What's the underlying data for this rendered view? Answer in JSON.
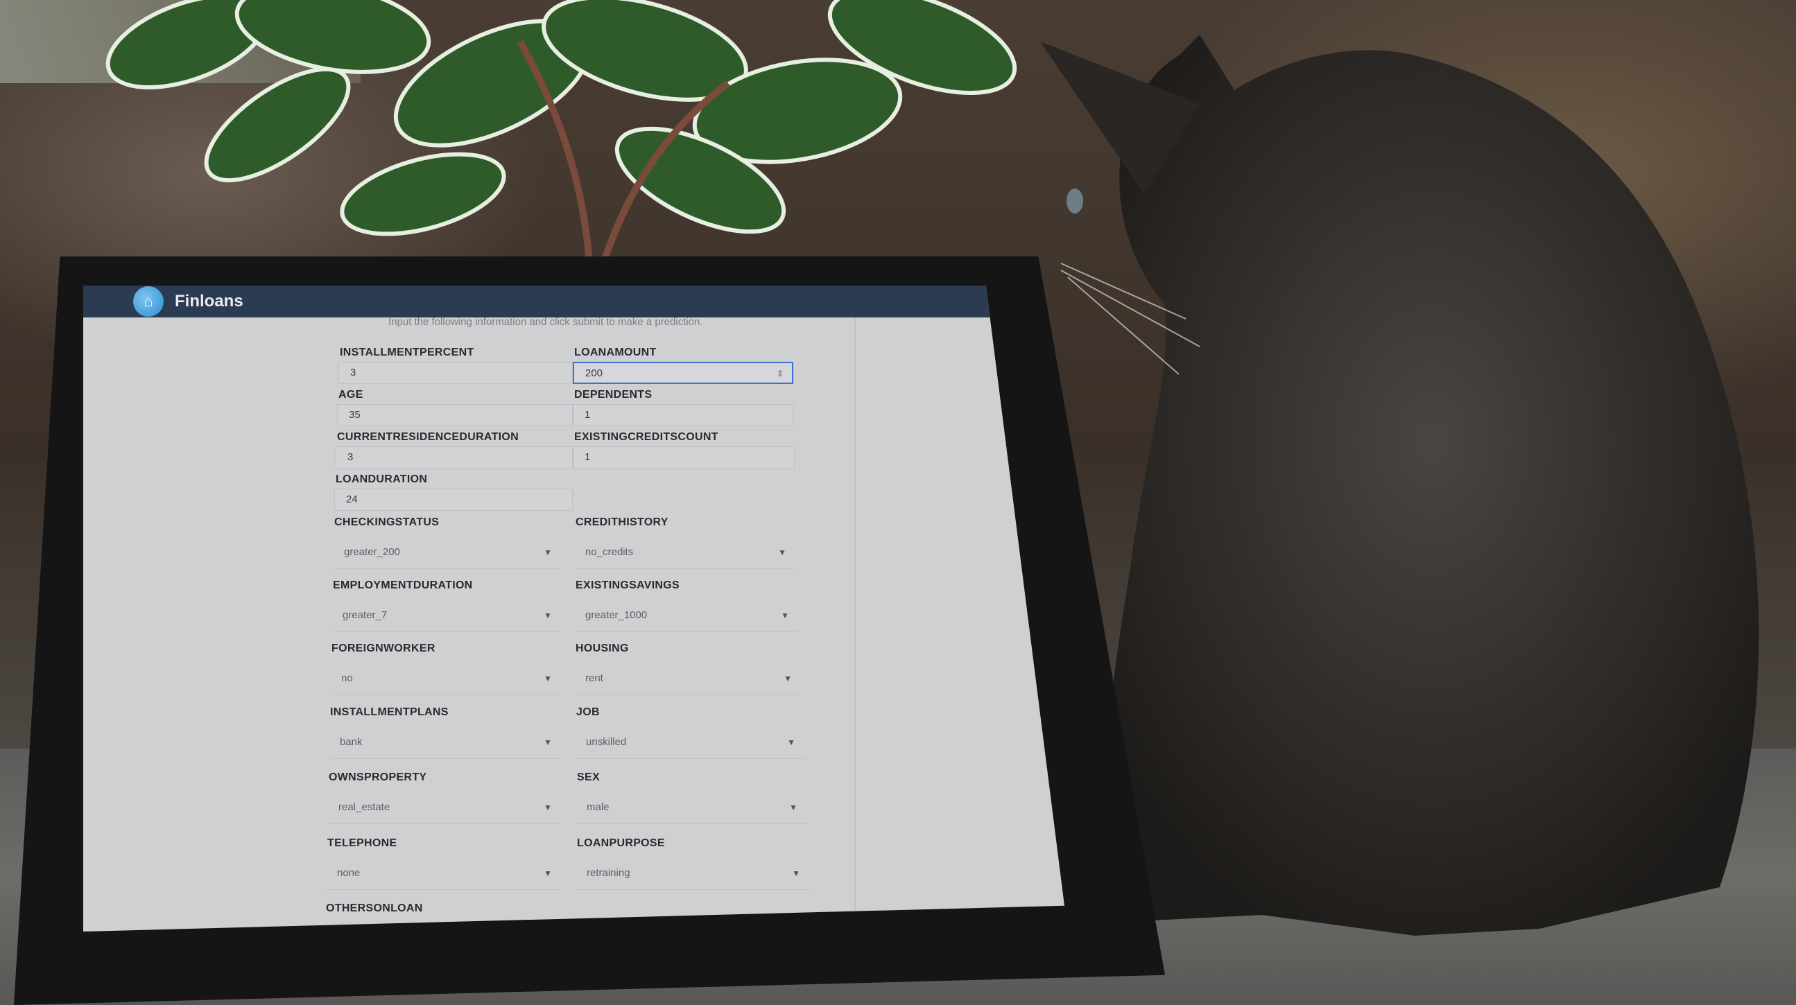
{
  "app": {
    "title": "Finloans",
    "logo_icon": "house-icon",
    "instruction": "Input the following information and click submit to make a prediction."
  },
  "numeric_fields": {
    "installmentpercent": {
      "label": "INSTALLMENTPERCENT",
      "value": "3"
    },
    "loanamount": {
      "label": "LOANAMOUNT",
      "value": "200"
    },
    "age": {
      "label": "AGE",
      "value": "35"
    },
    "dependents": {
      "label": "DEPENDENTS",
      "value": "1"
    },
    "currentresidenceduration": {
      "label": "CURRENTRESIDENCEDURATION",
      "value": "3"
    },
    "existingcreditscount": {
      "label": "EXISTINGCREDITSCOUNT",
      "value": "1"
    },
    "loanduration": {
      "label": "LOANDURATION",
      "value": "24"
    }
  },
  "select_fields": {
    "checkingstatus": {
      "label": "CHECKINGSTATUS",
      "value": "greater_200"
    },
    "credithistory": {
      "label": "CREDITHISTORY",
      "value": "no_credits"
    },
    "employmentduration": {
      "label": "EMPLOYMENTDURATION",
      "value": "greater_7"
    },
    "existingsavings": {
      "label": "EXISTINGSAVINGS",
      "value": "greater_1000"
    },
    "foreignworker": {
      "label": "FOREIGNWORKER",
      "value": "no"
    },
    "housing": {
      "label": "HOUSING",
      "value": "rent"
    },
    "installmentplans": {
      "label": "INSTALLMENTPLANS",
      "value": "bank"
    },
    "job": {
      "label": "JOB",
      "value": "unskilled"
    },
    "ownsproperty": {
      "label": "OWNSPROPERTY",
      "value": "real_estate"
    },
    "sex": {
      "label": "SEX",
      "value": "male"
    },
    "telephone": {
      "label": "TELEPHONE",
      "value": "none"
    },
    "loanpurpose": {
      "label": "LOANPURPOSE",
      "value": "retraining"
    },
    "othersonloan": {
      "label": "OTHERSONLOAN"
    }
  },
  "icons": {
    "dropdown": "chevron-down-icon",
    "stepper": "spin-stepper-icon"
  },
  "colors": {
    "appbar": "#2b3b51",
    "focus_border": "#3b6fd0",
    "screen_bg": "#cfd0d2"
  }
}
